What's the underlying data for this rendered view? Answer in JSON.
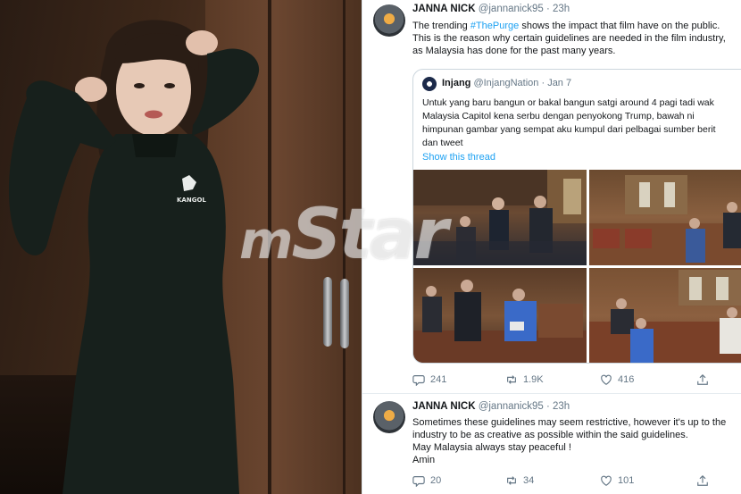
{
  "photo": {
    "sweater_logo": "KANGOL"
  },
  "tweet1": {
    "name": "JANNA NICK",
    "handle": "@jannanick95",
    "separator": "·",
    "time": "23h",
    "line1_pre": "The trending ",
    "line1_tag": "#ThePurge",
    "line1_post": " shows the impact that film have on the public.",
    "line2": "This is the reason why certain guidelines are needed in the film industry,",
    "line3": "as Malaysia has done for the past many years.",
    "quote": {
      "name": "Injang",
      "handle": "@InjangNation",
      "separator": "·",
      "time": "Jan 7",
      "line1": "Untuk yang baru bangun or bakal bangun satgi around 4 pagi tadi wak",
      "line2": "Malaysia Capitol kena serbu dengan penyokong Trump, bawah ni",
      "line3": "himpunan gambar yang sempat aku kumpul dari pelbagai sumber berit",
      "line4": "dan tweet",
      "show_thread": "Show this thread"
    },
    "replies": "241",
    "retweets": "1.9K",
    "likes": "416"
  },
  "tweet2": {
    "name": "JANNA NICK",
    "handle": "@jannanick95",
    "separator": "·",
    "time": "23h",
    "line1": "Sometimes these guidelines may seem restrictive, however it's up to the",
    "line2": "industry to be as creative as possible within the said guidelines.",
    "line3": "May Malaysia always stay peaceful !",
    "line4": "Amin",
    "replies": "20",
    "retweets": "34",
    "likes": "101"
  },
  "watermark": {
    "prefix": "m",
    "text": "Star"
  },
  "colors": {
    "link": "#1da1f2",
    "muted": "#657786",
    "text": "#14171a",
    "border": "#ccd6dd"
  }
}
